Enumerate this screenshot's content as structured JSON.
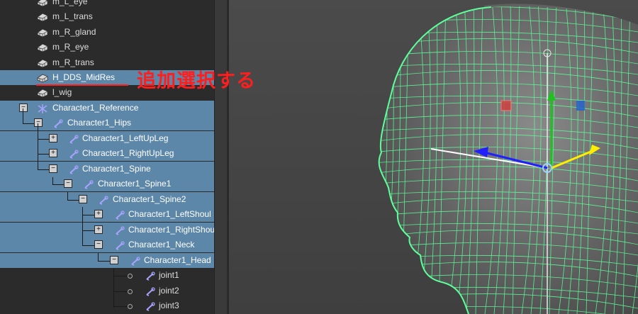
{
  "outliner": {
    "items": [
      {
        "label": "m_L_eye",
        "icon": "mesh-icon"
      },
      {
        "label": "m_L_trans",
        "icon": "mesh-icon"
      },
      {
        "label": "m_R_gland",
        "icon": "mesh-icon"
      },
      {
        "label": "m_R_eye",
        "icon": "mesh-icon"
      },
      {
        "label": "m_R_trans",
        "icon": "mesh-icon"
      },
      {
        "label": "H_DDS_MidRes",
        "icon": "mesh-icon"
      },
      {
        "label": "l_wig",
        "icon": "mesh-icon"
      },
      {
        "label": "Character1_Reference",
        "icon": "reference-icon",
        "expander": "−"
      },
      {
        "label": "Character1_Hips",
        "icon": "joint-icon",
        "expander": "−"
      },
      {
        "label": "Character1_LeftUpLeg",
        "icon": "joint-icon",
        "expander": "+"
      },
      {
        "label": "Character1_RightUpLeg",
        "icon": "joint-icon",
        "expander": "+"
      },
      {
        "label": "Character1_Spine",
        "icon": "joint-icon",
        "expander": "−"
      },
      {
        "label": "Character1_Spine1",
        "icon": "joint-icon",
        "expander": "−"
      },
      {
        "label": "Character1_Spine2",
        "icon": "joint-icon",
        "expander": "−"
      },
      {
        "label": "Character1_LeftShoul",
        "icon": "joint-icon",
        "expander": "+"
      },
      {
        "label": "Character1_RightShou",
        "icon": "joint-icon",
        "expander": "+"
      },
      {
        "label": "Character1_Neck",
        "icon": "joint-icon",
        "expander": "−"
      },
      {
        "label": "Character1_Head",
        "icon": "joint-icon",
        "expander": "−"
      },
      {
        "label": "joint1",
        "icon": "joint-icon"
      },
      {
        "label": "joint2",
        "icon": "joint-icon"
      },
      {
        "label": "joint3",
        "icon": "joint-icon"
      }
    ]
  },
  "annotation": {
    "text": "追加選択する"
  },
  "colors": {
    "selection": "#5d87a9",
    "wireframe": "#5dff9a",
    "annotation": "#ff1e1e",
    "joint": "#a8a4ff"
  }
}
